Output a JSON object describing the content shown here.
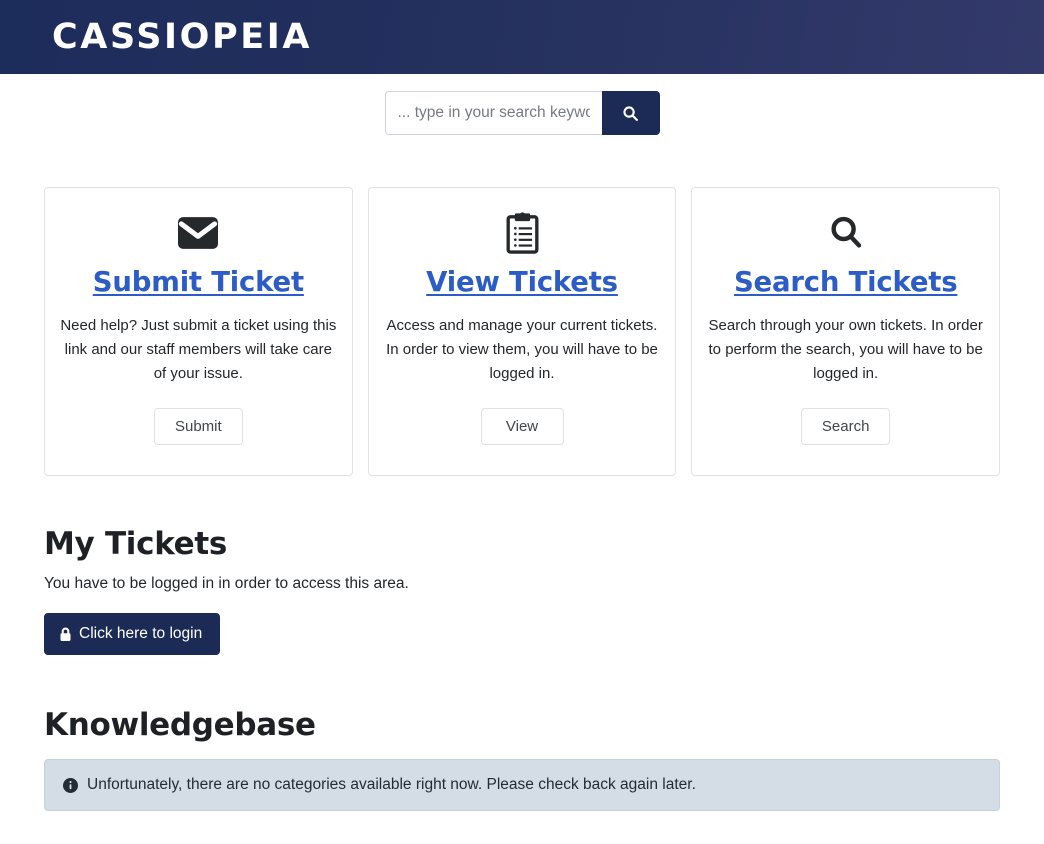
{
  "header": {
    "brand": "CASSIOPEIA"
  },
  "search": {
    "placeholder": "... type in your search keyword",
    "value": "",
    "button_icon": "search-icon",
    "button_label": ""
  },
  "cards": [
    {
      "icon": "envelope-icon",
      "title": "Submit Ticket",
      "text": "Need help? Just submit a ticket using this link and our staff members will take care of your issue.",
      "button": "Submit"
    },
    {
      "icon": "clipboard-list-icon",
      "title": "View Tickets",
      "text": "Access and manage your current tickets. In order to view them, you will have to be logged in.",
      "button": "View"
    },
    {
      "icon": "search-icon",
      "title": "Search Tickets",
      "text": "Search through your own tickets. In order to perform the search, you will have to be logged in.",
      "button": "Search"
    }
  ],
  "my_tickets": {
    "title": "My Tickets",
    "text": "You have to be logged in in order to access this area.",
    "login_button": "Click here to login",
    "login_icon": "lock-icon"
  },
  "knowledgebase": {
    "title": "Knowledgebase",
    "alert_icon": "info-circle-icon",
    "alert_text": "Unfortunately, there are no categories available right now. Please check back again later."
  },
  "colors": {
    "brand_navy": "#1b2b55",
    "link_blue": "#2c5cc5",
    "alert_bg": "#d4dde6",
    "card_border": "#dee2e6"
  }
}
